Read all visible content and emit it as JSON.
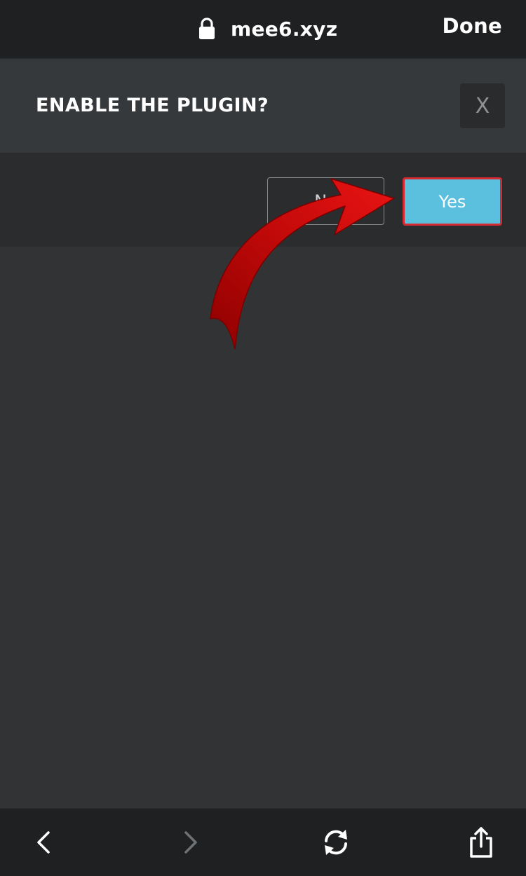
{
  "browser": {
    "url": "mee6.xyz",
    "done_label": "Done",
    "lock_icon": "lock-icon"
  },
  "dialog": {
    "title": "ENABLE THE PLUGIN?",
    "close_label": "X",
    "no_label": "No",
    "yes_label": "Yes"
  },
  "toolbar": {
    "back_icon": "chevron-left-icon",
    "forward_icon": "chevron-right-icon",
    "reload_icon": "reload-icon",
    "share_icon": "share-icon"
  },
  "colors": {
    "page_background": "#313335",
    "bar_background": "#1f2022",
    "yes_button": "#5bc0de",
    "highlight_border": "#d42a32",
    "annotation_arrow": "#c50a0a"
  }
}
